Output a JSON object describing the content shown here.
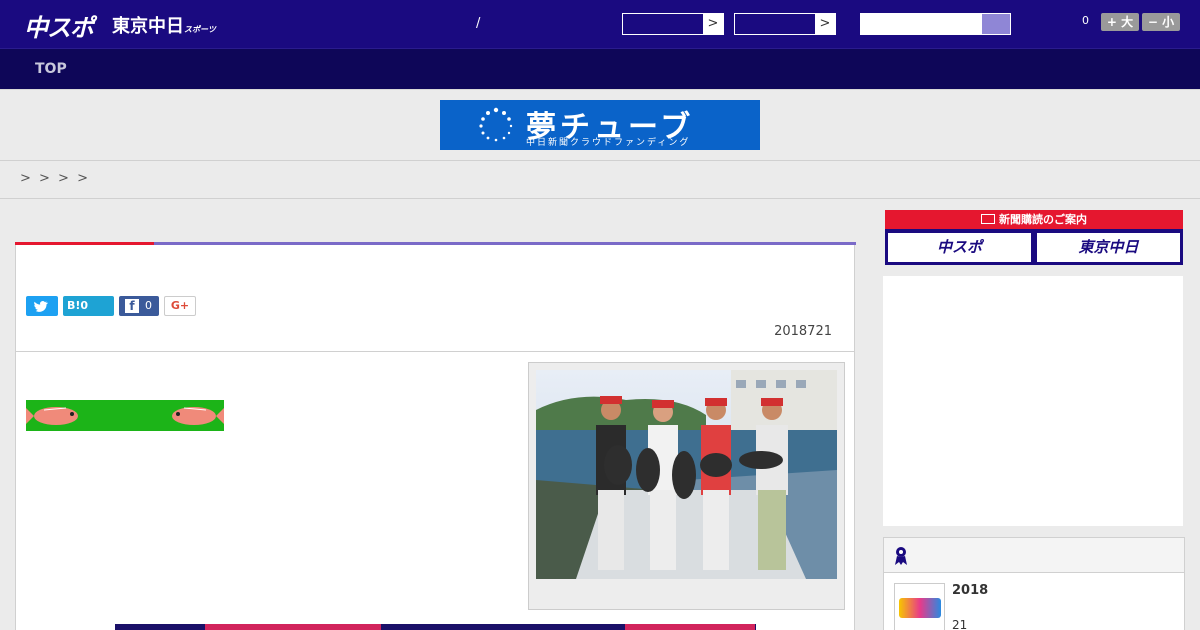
{
  "header": {
    "logo_chuspo": "中スポ",
    "logo_tokyo": "東京中日",
    "logo_tokyo_sub": "スポーツ",
    "separator": "/",
    "select_arrow": ">",
    "count": "0",
    "font_large": "+ 大",
    "font_small": "− 小"
  },
  "nav": {
    "top_label": "TOP"
  },
  "banner": {
    "title": "夢チューブ",
    "subtitle": "中日新聞クラウドファンディング"
  },
  "breadcrumb": {
    "text": "> > > >"
  },
  "article": {
    "share_fb_count": "0",
    "share_hatena": "B!0",
    "share_gplus": "G+",
    "date": "2018721"
  },
  "sidebar": {
    "newspaper_head": "新聞購読のご案内",
    "newspaper_chuspo": "中スポ",
    "newspaper_tokyo": "東京中日",
    "ranking": {
      "year": "2018",
      "day": "21"
    }
  },
  "colors": {
    "header_bg": "#1a0a80",
    "nav_bg": "#0e0658",
    "accent_red": "#e5172f",
    "accent_purple": "#7a6ac8",
    "banner_blue": "#0a63c9"
  }
}
